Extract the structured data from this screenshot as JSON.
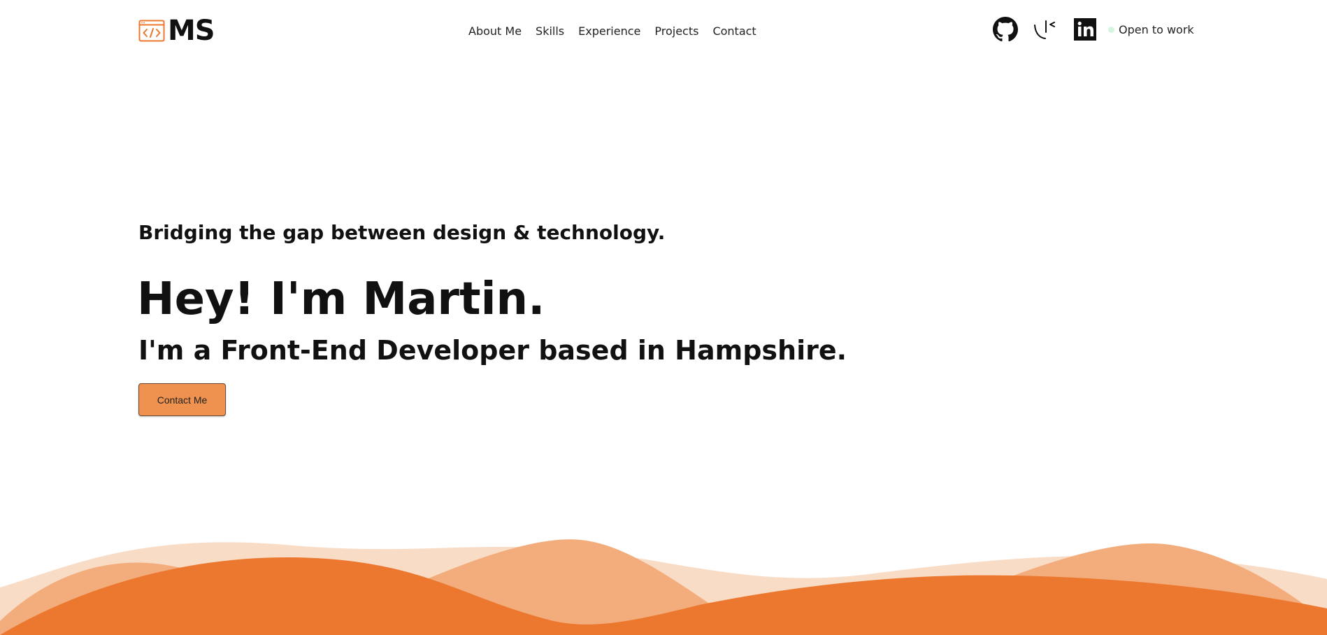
{
  "header": {
    "logo_text": "MS",
    "logo_icon": "code-window-icon",
    "nav": [
      {
        "label": "About Me"
      },
      {
        "label": "Skills"
      },
      {
        "label": "Experience"
      },
      {
        "label": "Projects"
      },
      {
        "label": "Contact"
      }
    ],
    "social": [
      {
        "name": "github-icon"
      },
      {
        "name": "kaggle-style-icon"
      },
      {
        "name": "linkedin-icon"
      }
    ],
    "status_text": "Open to work",
    "status_color": "#d6f5df"
  },
  "hero": {
    "tagline": "Bridging the gap between design & technology.",
    "title": "Hey! I'm Martin.",
    "subtitle": "I'm a Front-End Developer based in Hampshire.",
    "cta_label": "Contact Me"
  },
  "colors": {
    "accent": "#eb782e",
    "button": "#f0924f",
    "wave_light": "#f9dcc6",
    "wave_mid": "#f3ad7c",
    "wave_dark": "#eb782e"
  }
}
